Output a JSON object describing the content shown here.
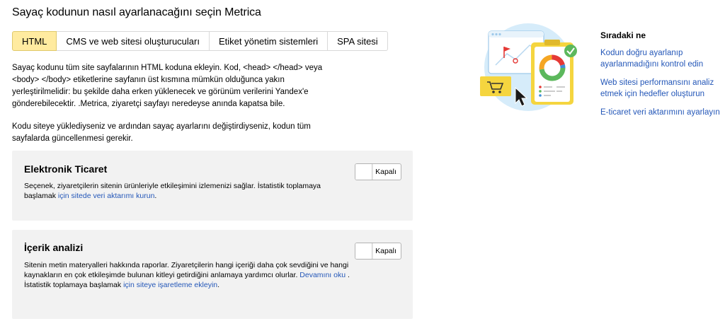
{
  "page": {
    "title": "Sayaç kodunun nasıl ayarlanacağını seçin Metrica"
  },
  "tabs": [
    {
      "label": "HTML",
      "active": true
    },
    {
      "label": "CMS ve web sitesi oluşturucuları",
      "active": false
    },
    {
      "label": "Etiket yönetim sistemleri",
      "active": false
    },
    {
      "label": "SPA sitesi",
      "active": false
    }
  ],
  "description": {
    "p1": "Sayaç kodunu tüm site sayfalarının HTML koduna ekleyin. Kod, <head> </head> veya <body> </body> etiketlerine sayfanın üst kısmına mümkün olduğunca yakın yerleştirilmelidir: bu şekilde daha erken yüklenecek ve görünüm verilerini Yandex'e gönderebilecektir. .Metrica, ziyaretçi sayfayı neredeyse anında kapatsa bile.",
    "p2": "Kodu siteye yüklediyseniz ve ardından sayaç ayarlarını değiştirdiyseniz, kodun tüm sayfalarda güncellenmesi gerekir."
  },
  "ecommerce": {
    "title": "Elektronik Ticaret",
    "text": "Seçenek, ziyaretçilerin sitenin ürünleriyle etkileşimini izlemenizi sağlar. İstatistik toplamaya başlamak ",
    "link": "için sitede veri aktarımı kurun",
    "text_end": ".",
    "toggle_label": "Kapalı"
  },
  "content_analysis": {
    "title": "İçerik analizi",
    "text": "Sitenin metin materyalleri hakkında raporlar. Ziyaretçilerin hangi içeriği daha çok sevdiğini ve hangi kaynakların en çok etkileşimde bulunan kitleyi getirdiğini anlamaya yardımcı olurlar. ",
    "link_more": "Devamını oku",
    "text_mid": " . İstatistik toplamaya başlamak ",
    "link_markup": "için siteye işaretleme ekleyin",
    "text_end": ".",
    "toggle_label": "Kapalı"
  },
  "next": {
    "title": "Sıradaki ne",
    "links": [
      "Kodun doğru ayarlanıp ayarlanmadığını kontrol edin",
      "Web sitesi performansını analiz etmek için hedefler oluşturun",
      "E-ticaret veri aktarımını ayarlayın"
    ]
  },
  "colors": {
    "active_tab": "#ffeba0",
    "link": "#2457b8",
    "card_bg": "#f2f2f2",
    "illus_circle": "#d6ecfa",
    "illus_yellow": "#f5d53f",
    "illus_green": "#5cb85c"
  },
  "icons": [
    "setup-illustration-icon",
    "shopping-cart-icon",
    "cursor-icon",
    "checkmark-badge-icon",
    "donut-chart-icon",
    "flag-icon"
  ]
}
